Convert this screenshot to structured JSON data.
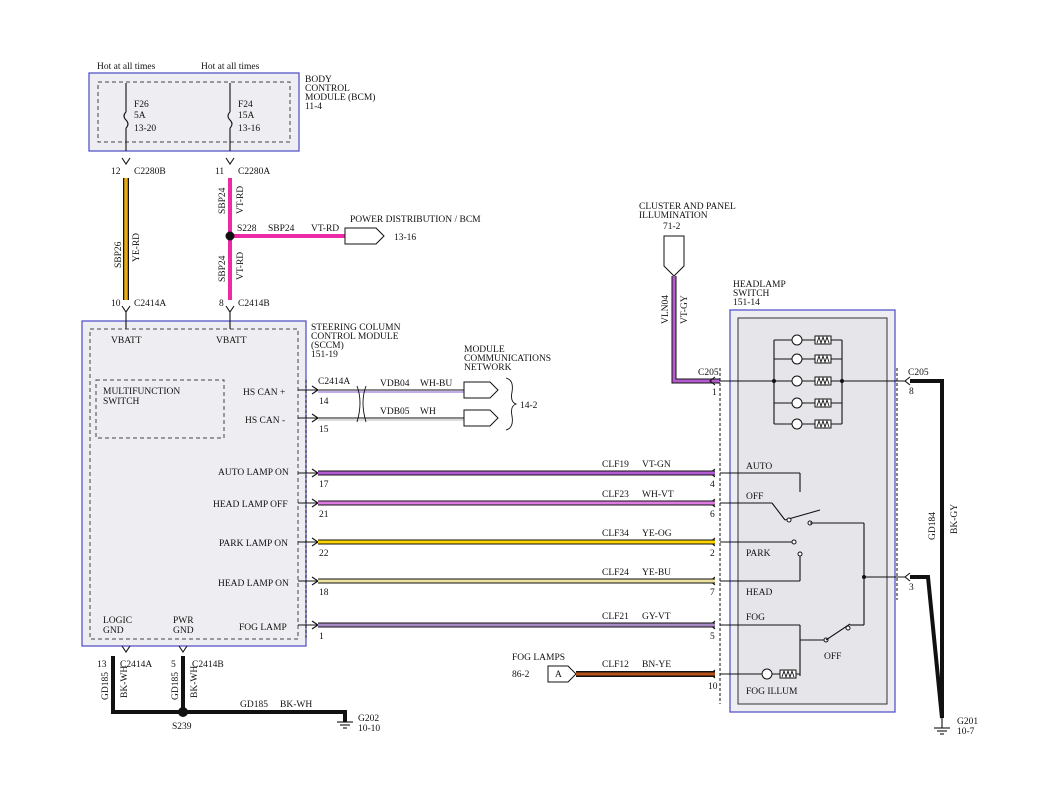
{
  "bcm": {
    "title_l1": "BODY",
    "title_l2": "CONTROL",
    "title_l3": "MODULE (BCM)",
    "page": "11-4",
    "hot1": "Hot at all times",
    "hot2": "Hot at all times",
    "fuse1": {
      "name": "F26",
      "amps": "5A",
      "ref": "13-20"
    },
    "fuse2": {
      "name": "F24",
      "amps": "15A",
      "ref": "13-16"
    },
    "pin_f26": "12",
    "conn_f26": "C2280B",
    "pin_f24": "11",
    "conn_f24": "C2280A"
  },
  "wires": {
    "sbp26": "SBP26",
    "yerd": "YE-RD",
    "sbp24": "SBP24",
    "vtrd": "VT-RD",
    "splice_s228": "S228",
    "power_dist": "POWER DISTRIBUTION / BCM",
    "power_dist_ref": "13-16"
  },
  "sccm": {
    "title_l1": "STEERING COLUMN",
    "title_l2": "CONTROL MODULE",
    "title_l3": "(SCCM)",
    "page": "151-19",
    "pin_top1": "10",
    "conn_top1": "C2414A",
    "pin_top2": "8",
    "conn_top2": "C2414B",
    "vbatt1": "VBATT",
    "vbatt2": "VBATT",
    "mfs_l1": "MULTIFUNCTION",
    "mfs_l2": "SWITCH",
    "hs_can_plus": "HS CAN +",
    "hs_can_minus": "HS CAN -",
    "auto_lamp_on": "AUTO LAMP ON",
    "head_lamp_off": "HEAD LAMP OFF",
    "park_lamp_on": "PARK LAMP ON",
    "head_lamp_on": "HEAD LAMP ON",
    "fog_lamp": "FOG LAMP",
    "logic_gnd_l1": "LOGIC",
    "logic_gnd_l2": "GND",
    "pwr_gnd_l1": "PWR",
    "pwr_gnd_l2": "GND"
  },
  "can": {
    "conn": "C2414A",
    "pin14": "14",
    "pin15": "15",
    "vdb04": "VDB04",
    "whbu": "WH-BU",
    "vdb05": "VDB05",
    "wh": "WH",
    "net_l1": "MODULE",
    "net_l2": "COMMUNICATIONS",
    "net_l3": "NETWORK",
    "net_ref": "14-2"
  },
  "circuits": [
    {
      "code": "CLF19",
      "color": "VT-GN",
      "pin_l": "17",
      "pin_r": "4",
      "sw": "AUTO"
    },
    {
      "code": "CLF23",
      "color": "WH-VT",
      "pin_l": "21",
      "pin_r": "6",
      "sw": "OFF"
    },
    {
      "code": "CLF34",
      "color": "YE-OG",
      "pin_l": "22",
      "pin_r": "2",
      "sw": "PARK"
    },
    {
      "code": "CLF24",
      "color": "YE-BU",
      "pin_l": "18",
      "pin_r": "7",
      "sw": "HEAD"
    },
    {
      "code": "CLF21",
      "color": "GY-VT",
      "pin_l": "1",
      "pin_r": "5",
      "sw": "FOG"
    }
  ],
  "fog": {
    "title": "FOG LAMPS",
    "ref": "86-2",
    "connector": "A",
    "code": "CLF12",
    "color": "BN-YE",
    "pin": "10"
  },
  "cluster": {
    "l1": "CLUSTER AND PANEL",
    "l2": "ILLUMINATION",
    "ref": "71-2",
    "code": "VLN04",
    "color": "VT-GY",
    "conn": "C205",
    "pin": "1"
  },
  "hls": {
    "title_l1": "HEADLAMP",
    "title_l2": "SWITCH",
    "page": "151-14",
    "fog_off": "OFF",
    "fog_illum": "FOG ILLUM",
    "conn_r": "C205",
    "pin8": "8",
    "pin3": "3",
    "gd184": "GD184",
    "bkgy": "BK-GY"
  },
  "ground": {
    "pin13": "13",
    "conn13": "C2414A",
    "pin5": "5",
    "conn5": "C2414B",
    "gd185a": "GD185",
    "bkwha": "BK-WH",
    "gd185b": "GD185",
    "bkwhb": "BK-WH",
    "gd185c": "GD185",
    "bkwhc": "BK-WH",
    "splice": "S239",
    "g202": "G202",
    "g202_ref": "10-10",
    "g201": "G201",
    "g201_ref": "10-7"
  },
  "colors": {
    "yerd": "#e7ab14",
    "vtrd": "#ec2aa6",
    "vtgn": "#b45ad2",
    "whvt": "#e07ae2",
    "yeog": "#fbd400",
    "yebu": "#ece2a0",
    "gyvt": "#a88ac4",
    "bnye": "#b8521a",
    "vtgy": "#b65ad2"
  }
}
